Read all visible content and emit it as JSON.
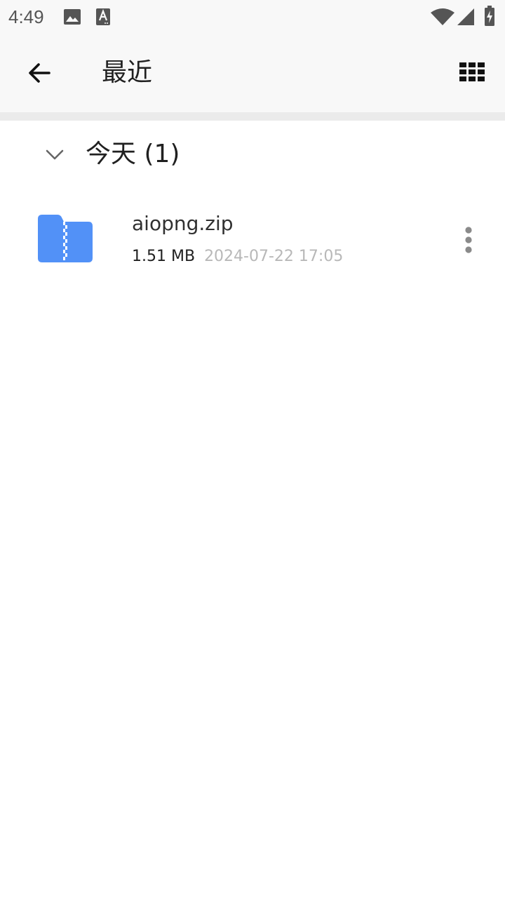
{
  "status_bar": {
    "time": "4:49",
    "icons": [
      "image-icon",
      "font-icon",
      "wifi-icon",
      "signal-icon",
      "battery-charging-icon"
    ]
  },
  "app_bar": {
    "title": "最近",
    "back_icon": "arrow-left-icon",
    "view_icon": "grid-view-icon"
  },
  "section": {
    "title": "今天 (1)",
    "expanded": true,
    "icon": "chevron-down-icon"
  },
  "files": [
    {
      "name": "aiopng.zip",
      "size": "1.51 MB",
      "date": "2024-07-22 17:05",
      "icon": "zip-folder-icon"
    }
  ],
  "colors": {
    "folder": "#5291f7",
    "background": "#ffffff",
    "app_bar": "#f8f8f8",
    "divider": "#ebebeb",
    "secondary_text": "#b8b8b8"
  }
}
